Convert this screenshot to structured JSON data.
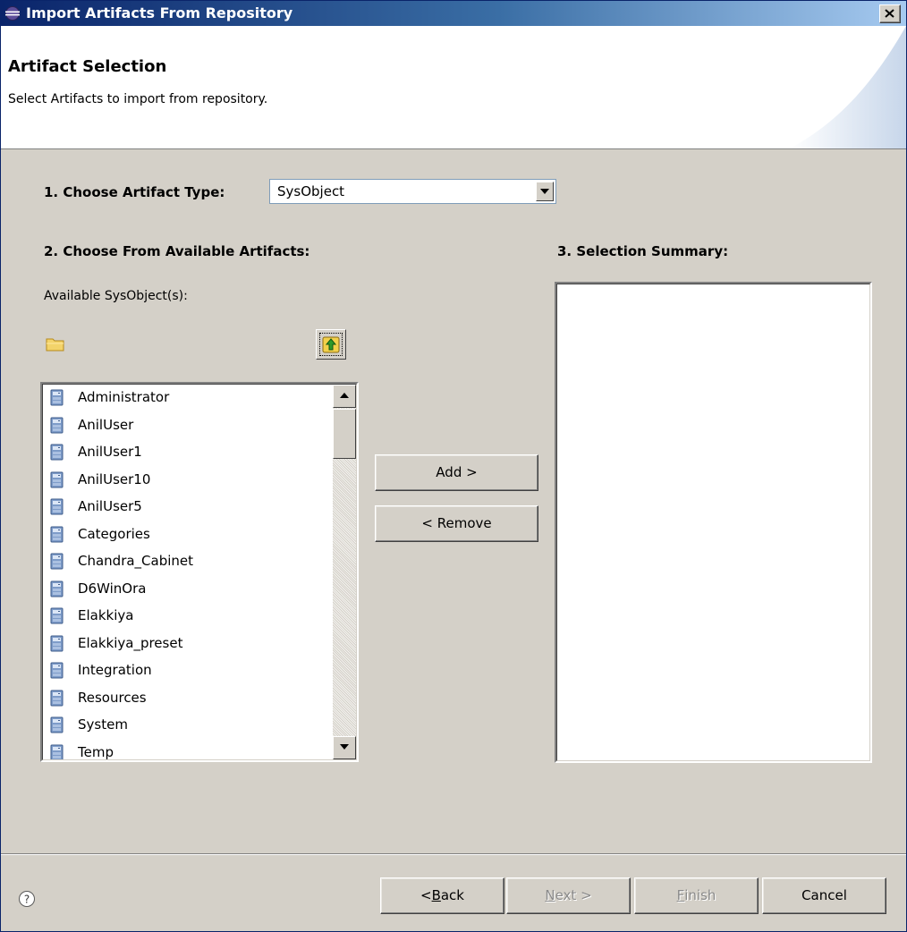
{
  "window": {
    "title": "Import Artifacts From Repository"
  },
  "header": {
    "title": "Artifact Selection",
    "description": "Select Artifacts to import from repository."
  },
  "step1": {
    "label": "1. Choose Artifact Type:",
    "selected": "SysObject"
  },
  "step2": {
    "label": "2. Choose From Available Artifacts:",
    "available_label": "Available SysObject(s):",
    "items": [
      "Administrator",
      "AnilUser",
      "AnilUser1",
      "AnilUser10",
      "AnilUser5",
      "Categories",
      "Chandra_Cabinet",
      "D6WinOra",
      "Elakkiya",
      "Elakkiya_preset",
      "Integration",
      "Resources",
      "System",
      "Temp"
    ]
  },
  "step3": {
    "label": "3. Selection Summary:"
  },
  "actions": {
    "add": "Add >",
    "remove": "< Remove"
  },
  "footer": {
    "back_prefix": "< ",
    "back_key": "B",
    "back_rest": "ack",
    "next_key": "N",
    "next_rest": "ext >",
    "finish_key": "F",
    "finish_rest": "inish",
    "cancel": "Cancel"
  },
  "icons": {
    "title": "eclipse-icon",
    "close": "close-icon",
    "folder": "folder-icon",
    "up": "up-level-icon",
    "item": "cabinet-icon",
    "help": "help-icon"
  },
  "colors": {
    "title_bar": "#0a246a",
    "dialog_bg": "#d4d0c8",
    "disabled_text": "#8a8a8a"
  }
}
